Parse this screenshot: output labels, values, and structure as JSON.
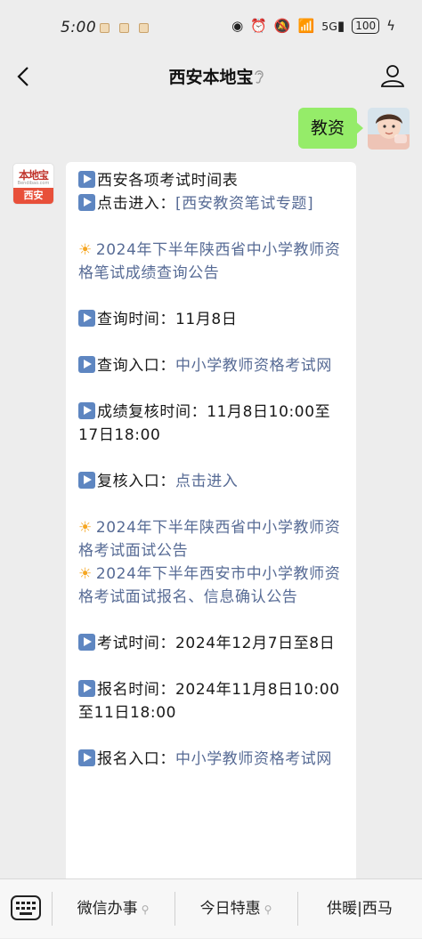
{
  "status_bar": {
    "time": "5:00",
    "network": "5G",
    "battery": "100"
  },
  "nav": {
    "title": "西安本地宝"
  },
  "sent": {
    "text": "教资"
  },
  "bot_avatar": {
    "logo_top": "本地宝",
    "logo_mid": "Bendibao.com",
    "logo_bottom": "西安"
  },
  "message": {
    "l1": "西安各项考试时间表",
    "l2_prefix": "点击进入：",
    "l2_link": "[西安教资笔试专题]",
    "notice1": "2024年下半年陕西省中小学教师资格笔试成绩查询公告",
    "query_time_label": "查询时间：",
    "query_time_value": "11月8日",
    "query_entry_label": "查询入口：",
    "query_entry_link": "中小学教师资格考试网",
    "review_time_label": "成绩复核时间：",
    "review_time_value": "11月8日10:00至17日18:00",
    "review_entry_label": "复核入口：",
    "review_entry_link": "点击进入",
    "notice2": "2024年下半年陕西省中小学教师资格考试面试公告",
    "notice3": "2024年下半年西安市中小学教师资格考试面试报名、信息确认公告",
    "exam_time_label": "考试时间：",
    "exam_time_value": "2024年12月7日至8日",
    "signup_time_label": "报名时间：",
    "signup_time_value": "2024年11月8日10:00至11日18:00",
    "signup_entry_label": "报名入口：",
    "signup_entry_link": "中小学教师资格考试网"
  },
  "menu": {
    "item1": "微信办事",
    "item2": "今日特惠",
    "item3": "供暖|西马"
  },
  "colors": {
    "link": "#576b95",
    "sent_bubble": "#95ec69",
    "play_icon": "#5e86c1",
    "sun_icon": "#f5a623"
  }
}
